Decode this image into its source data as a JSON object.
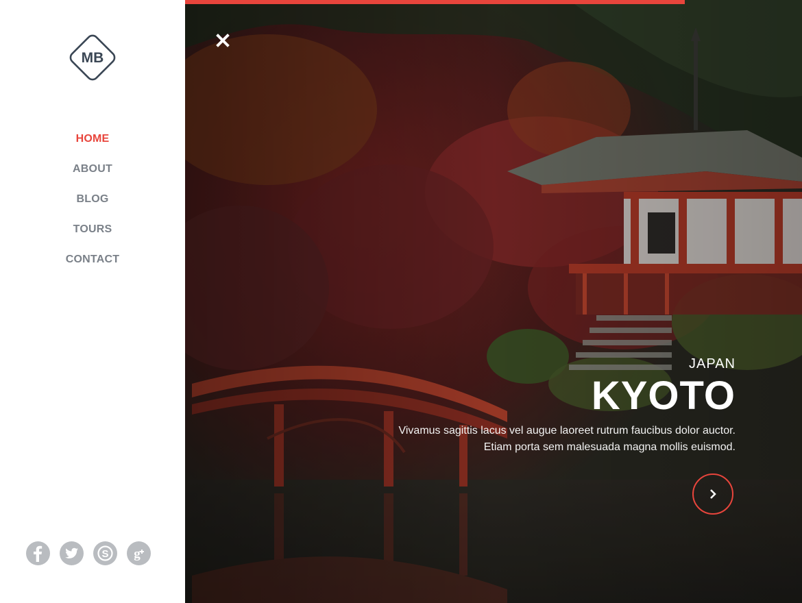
{
  "brand": {
    "logo_text": "MB"
  },
  "nav": [
    {
      "label": "HOME",
      "active": true
    },
    {
      "label": "ABOUT",
      "active": false
    },
    {
      "label": "BLOG",
      "active": false
    },
    {
      "label": "TOURS",
      "active": false
    },
    {
      "label": "CONTACT",
      "active": false
    }
  ],
  "social": [
    "facebook-icon",
    "twitter-icon",
    "skype-icon",
    "google-plus-icon"
  ],
  "slide": {
    "country": "JAPAN",
    "city": "KYOTO",
    "description_line1": "Vivamus sagittis lacus vel augue laoreet rutrum faucibus dolor auctor.",
    "description_line2": "Etiam porta sem malesuada magna mollis euismod.",
    "progress_percent": 81
  },
  "colors": {
    "accent": "#e8453c",
    "nav_text": "#7a8088",
    "logo": "#3a4654",
    "social": "#b9bcc0"
  }
}
